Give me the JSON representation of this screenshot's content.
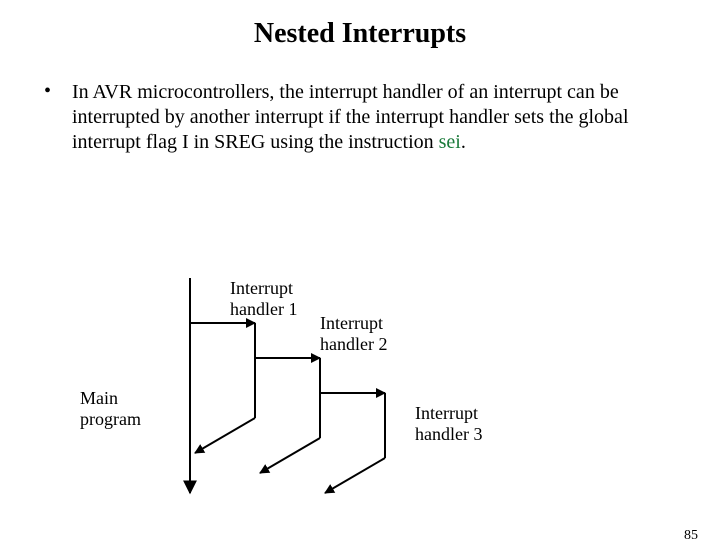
{
  "title": "Nested Interrupts",
  "bullet": {
    "mark": "•",
    "text_pre": "In AVR microcontrollers, the interrupt handler of an interrupt can be interrupted by another interrupt if the interrupt handler sets the global interrupt flag I in SREG using the instruction ",
    "sei": "sei",
    "text_post": "."
  },
  "labels": {
    "main_l1": "Main",
    "main_l2": "program",
    "h1_l1": "Interrupt",
    "h1_l2": "handler 1",
    "h2_l1": "Interrupt",
    "h2_l2": "handler 2",
    "h3_l1": "Interrupt",
    "h3_l2": "handler 3"
  },
  "page_number": "85"
}
